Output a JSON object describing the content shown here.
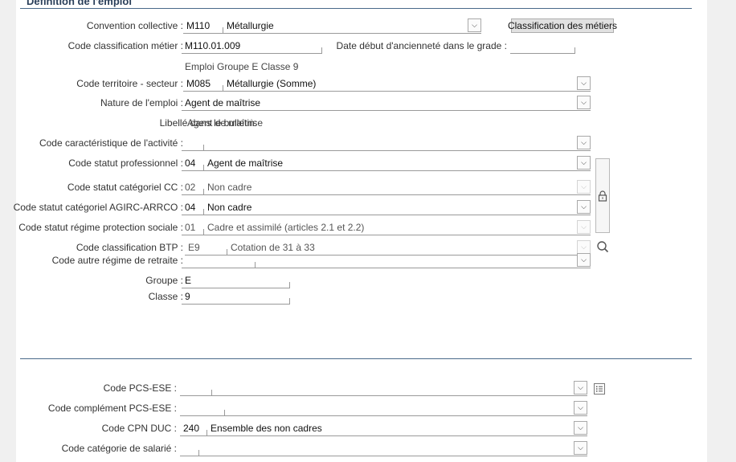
{
  "section": {
    "title": "Définition de l'emploi"
  },
  "convention": {
    "label": "Convention collective :",
    "code": "M110",
    "desc": "Métallurgie",
    "button": "Classification des métiers"
  },
  "code_classification": {
    "label": "Code classification métier :",
    "value": "M110.01.009"
  },
  "date_anciennete": {
    "label": "Date début d'ancienneté dans le grade :",
    "value": ""
  },
  "emploi_groupe": {
    "text": "Emploi Groupe E Classe 9"
  },
  "territoire": {
    "label": "Code territoire - secteur :",
    "code": "M085",
    "desc": "Métallurgie (Somme)"
  },
  "nature": {
    "label": "Nature de l'emploi :",
    "value": "Agent de  maîtrise"
  },
  "libelle": {
    "label": "Libellé dans le bulletin:",
    "value": "Agent de  maîtrise"
  },
  "activite": {
    "label": "Code caractéristique de l'activité :",
    "code": "",
    "desc": ""
  },
  "statut_pro": {
    "label": "Code statut professionnel :",
    "code": "04",
    "desc": "Agent de maîtrise"
  },
  "statut_cc": {
    "label": "Code statut catégoriel CC :",
    "code": "02",
    "desc": "Non cadre"
  },
  "statut_agirc": {
    "label": "Code statut catégoriel AGIRC-ARRCO :",
    "code": "04",
    "desc": "Non cadre"
  },
  "regime_protection": {
    "label": "Code statut régime protection sociale :",
    "code": "01",
    "desc": "Cadre et assimilé (articles 2.1 et 2.2)"
  },
  "classification_btp": {
    "label": "Code classification BTP :",
    "code": "E9",
    "desc": "Cotation de 31 à 33"
  },
  "autre_regime": {
    "label": "Code autre régime de retraite :",
    "code": "",
    "desc": ""
  },
  "groupe": {
    "label": "Groupe :",
    "value": "E"
  },
  "classe": {
    "label": "Classe :",
    "value": "9"
  },
  "pcs": {
    "label": "Code PCS-ESE :",
    "code": "",
    "desc": ""
  },
  "pcs_complement": {
    "label": "Code complément PCS-ESE :",
    "code": "",
    "desc": ""
  },
  "cpn_duc": {
    "label": "Code CPN DUC :",
    "code": "240",
    "desc": "Ensemble des non cadres"
  },
  "categorie_salarie": {
    "label": "Code catégorie de salarié :",
    "code": "",
    "desc": ""
  },
  "icons": {
    "dropdown": "chevron-down-icon",
    "lock": "padlock-icon",
    "search": "search-icon",
    "list": "list-icon"
  },
  "colors": {
    "panel": "#ffffff",
    "background": "#f0f0f0",
    "rule": "#4a6a8a",
    "title": "#2a3f5a"
  }
}
